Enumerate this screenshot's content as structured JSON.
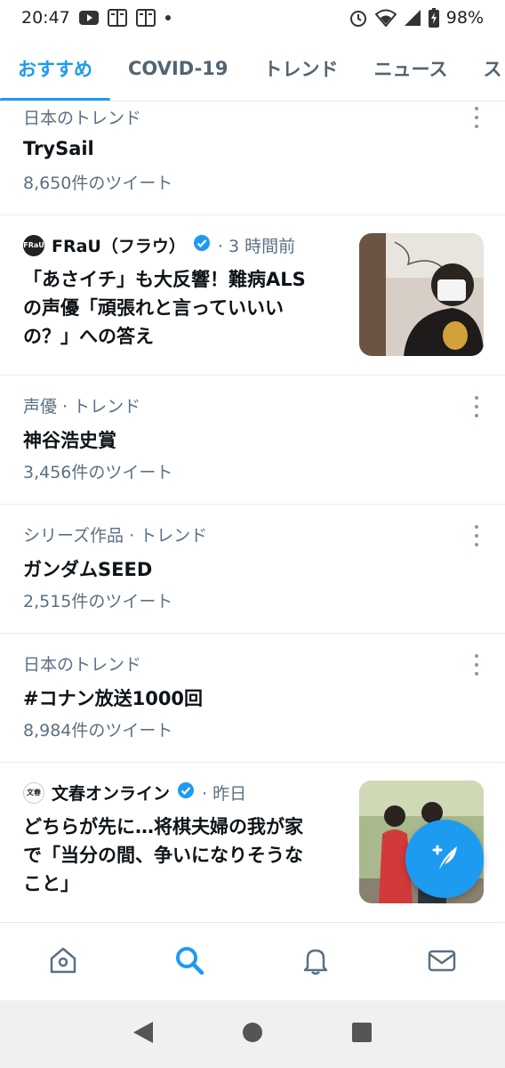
{
  "status_bar": {
    "time": "20:47",
    "battery": "98%",
    "left_icons": [
      "youtube-icon",
      "book-icon",
      "book-icon",
      "dot-icon"
    ],
    "right_icons": [
      "alarm-icon",
      "wifi-icon",
      "signal-icon",
      "battery-icon"
    ]
  },
  "tabs": [
    {
      "label": "おすすめ",
      "active": true
    },
    {
      "label": "COVID-19",
      "active": false
    },
    {
      "label": "トレンド",
      "active": false
    },
    {
      "label": "ニュース",
      "active": false
    },
    {
      "label": "ス",
      "active": false
    }
  ],
  "feed": {
    "trend_1": {
      "meta": "日本のトレンド",
      "title": "TrySail",
      "count": "8,650件のツイート"
    },
    "news_1": {
      "source": "FRaU（フラウ）",
      "avatar_text": "FRaU",
      "time": "· 3 時間前",
      "line1": "「あさイチ」も大反響！難病ALS",
      "line2": "の声優「頑張れと言っていいい",
      "line3": "の？」への答え"
    },
    "trend_2": {
      "meta": "声優 · トレンド",
      "title": "神谷浩史賞",
      "count": "3,456件のツイート"
    },
    "trend_3": {
      "meta": "シリーズ作品 · トレンド",
      "title": "ガンダムSEED",
      "count": "2,515件のツイート"
    },
    "trend_4": {
      "meta": "日本のトレンド",
      "title": "#コナン放送1000回",
      "count": "8,984件のツイート"
    },
    "news_2": {
      "source": "文春オンライン",
      "avatar_text": "文春",
      "time": "· 昨日",
      "line1": "どちらが先に…将棋夫婦の我が家",
      "line2": "で「当分の間、争いになりそうな",
      "line3": "こと」"
    }
  },
  "bottom_nav": [
    "home-icon",
    "search-icon",
    "bell-icon",
    "mail-icon"
  ],
  "colors": {
    "accent": "#1d9bf0",
    "text": "#0f1419",
    "secondary": "#5b7083"
  }
}
